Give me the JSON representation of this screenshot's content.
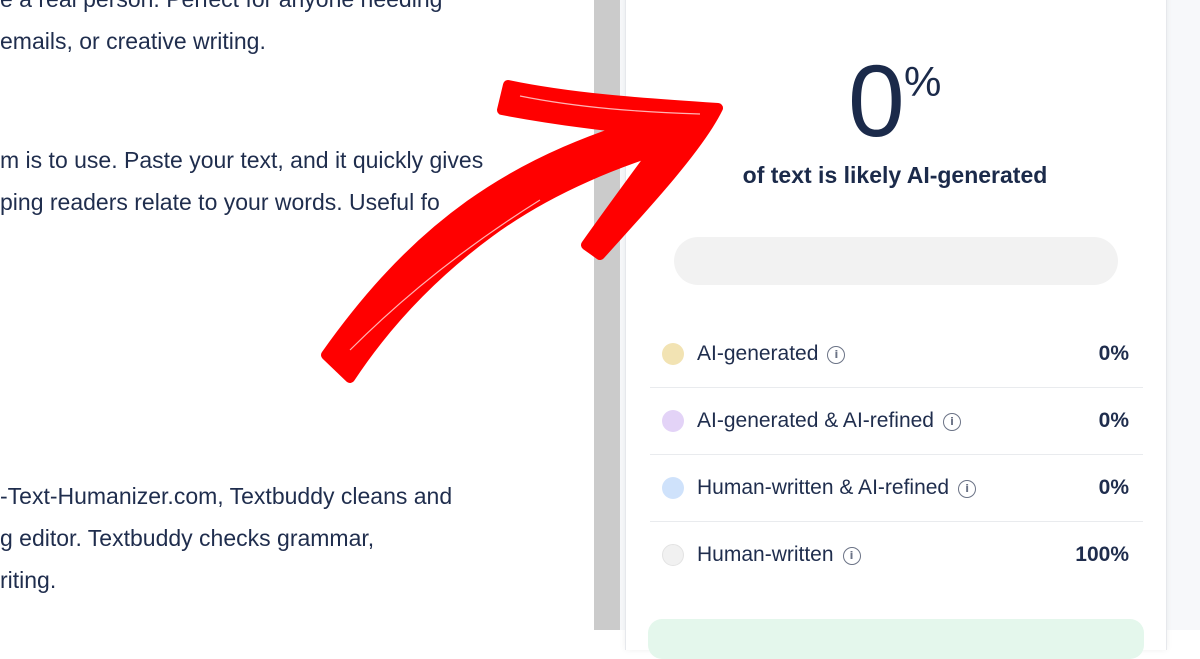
{
  "document": {
    "paragraphs": [
      [
        "e a real person. Perfect for anyone needing",
        "emails, or creative writing."
      ],
      [
        "m is to use. Paste your text, and it quickly gives",
        "ping readers relate to your words. Useful fo"
      ],
      [
        "-Text-Humanizer.com, Textbuddy cleans and",
        "g editor. Textbuddy checks grammar,",
        "riting."
      ]
    ]
  },
  "result": {
    "score_value": "0",
    "score_unit": "%",
    "caption": "of text is likely AI-generated",
    "progress_fraction": 0
  },
  "legend": [
    {
      "label": "AI-generated",
      "value": "0%",
      "color": "#f2e3b3"
    },
    {
      "label": "AI-generated & AI-refined",
      "value": "0%",
      "color": "#e3d3f7"
    },
    {
      "label": "Human-written & AI-refined",
      "value": "0%",
      "color": "#cfe2fb"
    },
    {
      "label": "Human-written",
      "value": "100%",
      "color": "#f1f1f1"
    }
  ],
  "colors": {
    "text": "#1f2d4d",
    "arrow": "#ff0000",
    "divider": "#cbcbcb"
  }
}
